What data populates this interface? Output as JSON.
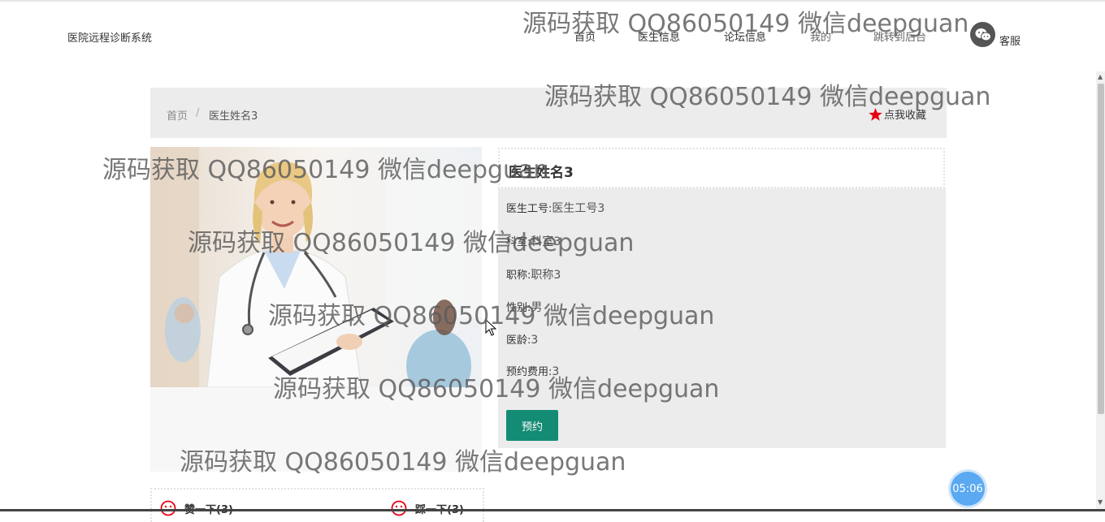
{
  "header": {
    "site_title": "医院远程诊断系统",
    "nav": [
      "首页",
      "医生信息",
      "论坛信息",
      "我的",
      "跳转到后台"
    ],
    "service_label": "客服"
  },
  "breadcrumb": {
    "home": "首页",
    "separator": "/",
    "current": "医生姓名3"
  },
  "favorite_label": "点我收藏",
  "doctor": {
    "name": "医生姓名3",
    "fields": [
      {
        "label": "医生工号:",
        "value": "医生工号3"
      },
      {
        "label": "科室:",
        "value": "科室3"
      },
      {
        "label": "职称:",
        "value": "职称3"
      },
      {
        "label": "性别:",
        "value": "男"
      },
      {
        "label": "医龄:",
        "value": "3"
      },
      {
        "label": "预约费用:",
        "value": "3"
      }
    ],
    "book_button": "预约"
  },
  "votes": {
    "thumbs_up": "赞一下(3)",
    "thumbs_down": "踩一下(3)"
  },
  "timer": "05:06",
  "watermark": "源码获取 QQ86050149 微信deepguan",
  "colors": {
    "book_button": "#148b74",
    "favorite_star": "#e60012",
    "timer": "#5aa9f2",
    "panel_bg": "#ececec"
  },
  "icons": [
    "wechat-icon",
    "star-icon",
    "sad-face-icon"
  ]
}
